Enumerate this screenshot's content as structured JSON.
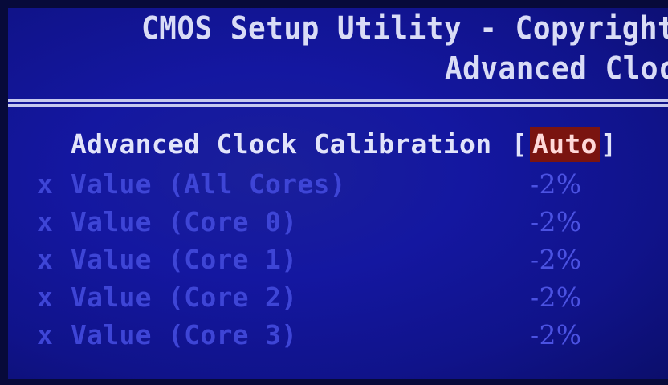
{
  "header": {
    "title_line1": "CMOS Setup Utility - Copyright",
    "title_line2": "Advanced Cloc"
  },
  "settings": {
    "acc": {
      "label": "Advanced Clock Calibration",
      "bracket_open": "[",
      "value": "Auto",
      "bracket_close": "]"
    },
    "items": [
      {
        "marker": "x",
        "label": "Value (All Cores)",
        "value": "-2%"
      },
      {
        "marker": "x",
        "label": "Value (Core 0)",
        "value": "-2%"
      },
      {
        "marker": "x",
        "label": "Value (Core 1)",
        "value": "-2%"
      },
      {
        "marker": "x",
        "label": "Value (Core 2)",
        "value": "-2%"
      },
      {
        "marker": "x",
        "label": "Value (Core 3)",
        "value": "-2%"
      }
    ]
  },
  "colors": {
    "background": "#1417a0",
    "text": "#e2e4fa",
    "disabled_text": "#3e45d6",
    "highlight_bg": "#7a1410",
    "highlight_text": "#ffd9d9"
  }
}
